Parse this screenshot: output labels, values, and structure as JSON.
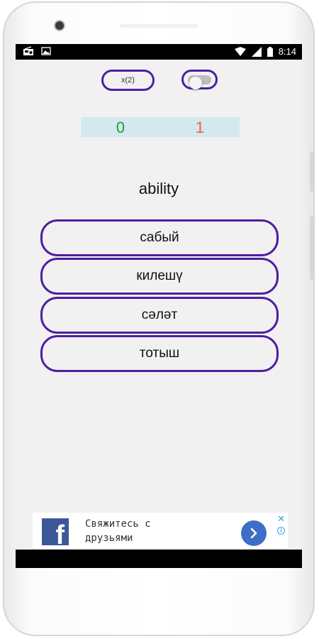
{
  "status_bar": {
    "time": "8:14",
    "icons": [
      "radio-icon",
      "image-icon",
      "wifi-icon",
      "signal-icon",
      "battery-icon"
    ]
  },
  "controls": {
    "multiplier_label": "x(2)",
    "toggle_on": false
  },
  "score": {
    "correct": "0",
    "wrong": "1"
  },
  "question": {
    "word": "ability"
  },
  "answers": [
    {
      "label": "сабый"
    },
    {
      "label": "килешү"
    },
    {
      "label": "сәләт"
    },
    {
      "label": "тотыш"
    }
  ],
  "ad": {
    "line1": "Свяжитесь с",
    "line2": "друзьями",
    "logo_letter": "f",
    "close": "✕",
    "info": "i"
  },
  "colors": {
    "accent": "#4b1fa3",
    "correct": "#1f9c3a",
    "wrong": "#f05a5a",
    "score_bg": "#d3e9ee",
    "facebook": "#3b5998"
  }
}
